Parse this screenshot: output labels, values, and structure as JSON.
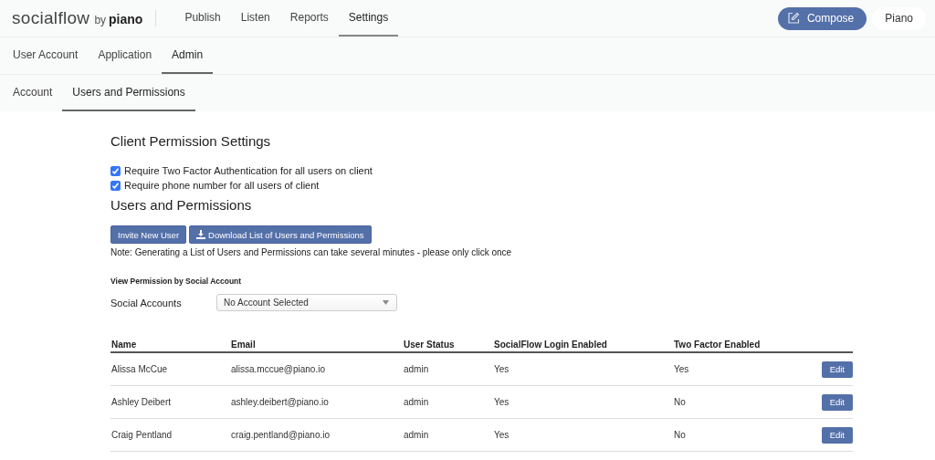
{
  "logo": {
    "name": "socialflow",
    "by": "by",
    "brand": "piano"
  },
  "main_nav": [
    {
      "label": "Publish",
      "selected": false
    },
    {
      "label": "Listen",
      "selected": false
    },
    {
      "label": "Reports",
      "selected": false
    },
    {
      "label": "Settings",
      "selected": true
    }
  ],
  "compose_button": "Compose",
  "user_menu": "Piano",
  "settings_tabs": [
    {
      "label": "User Account",
      "selected": false
    },
    {
      "label": "Application",
      "selected": false
    },
    {
      "label": "Admin",
      "selected": true
    }
  ],
  "admin_tabs": [
    {
      "label": "Account",
      "selected": false
    },
    {
      "label": "Users and Permissions",
      "selected": true
    }
  ],
  "client_settings": {
    "title": "Client Permission Settings",
    "options": [
      {
        "label": "Require Two Factor Authentication for all users on client",
        "checked": true
      },
      {
        "label": "Require phone number for all users of client",
        "checked": true
      }
    ]
  },
  "users_section": {
    "title": "Users and Permissions",
    "buttons": [
      {
        "label": "Invite New User",
        "kind": "plain"
      },
      {
        "label": "Download List of Users and Permissions",
        "kind": "download"
      }
    ],
    "note": "Note: Generating a List of Users and Permissions can take several minutes - please only click once"
  },
  "filter": {
    "heading": "View Permission by Social Account",
    "label": "Social Accounts",
    "value": "No Account Selected"
  },
  "table": {
    "columns": [
      "Name",
      "Email",
      "User Status",
      "SocialFlow Login Enabled",
      "Two Factor Enabled"
    ],
    "rows": [
      {
        "cells": [
          "Alissa McCue",
          "alissa.mccue@piano.io",
          "admin",
          "Yes",
          "Yes"
        ],
        "action": "Edit"
      },
      {
        "cells": [
          "Ashley Deibert",
          "ashley.deibert@piano.io",
          "admin",
          "Yes",
          "No"
        ],
        "action": "Edit"
      },
      {
        "cells": [
          "Craig Pentland",
          "craig.pentland@piano.io",
          "admin",
          "Yes",
          "No"
        ],
        "action": "Edit"
      }
    ]
  }
}
